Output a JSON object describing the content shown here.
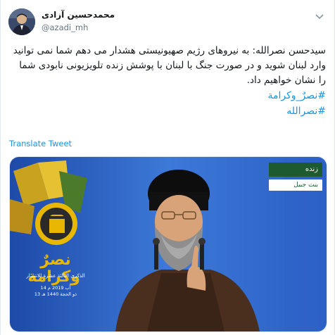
{
  "tweet": {
    "display_name": "محمدحسین آزادی",
    "handle": "@azadi_mh",
    "text": "سیدحسن نصرالله: به نیروهای رژیم صهیونیستی هشدار می دهم شما نمی توانید وارد لبنان شوید و در صورت جنگ با لبنان با پوشش زنده تلویزیونی نابودی شما را نشان خواهیم داد.",
    "hashtags": [
      "#نصرٌ_وكرامة",
      "#نصرالله"
    ],
    "translate_label": "Translate Tweet"
  },
  "media": {
    "live_label": "زنده",
    "location_label": "بنت جبيل",
    "event_title": "نصرٌ وكرامة",
    "event_subtitle": "الذكرى الثالثة عشرة للانتصار",
    "event_date_line1": "14 آب 2019 م",
    "event_date_line2": "13 ذو الحجة 1440 هـ"
  },
  "colors": {
    "link": "#1b95e0",
    "text": "#14171a",
    "muted": "#657786",
    "stage_blue": "#2a5fc4",
    "broadcast_green": "#1d5a2f",
    "banner_yellow": "#e8b800"
  },
  "icons": [
    "avatar",
    "chevron-down-icon"
  ]
}
